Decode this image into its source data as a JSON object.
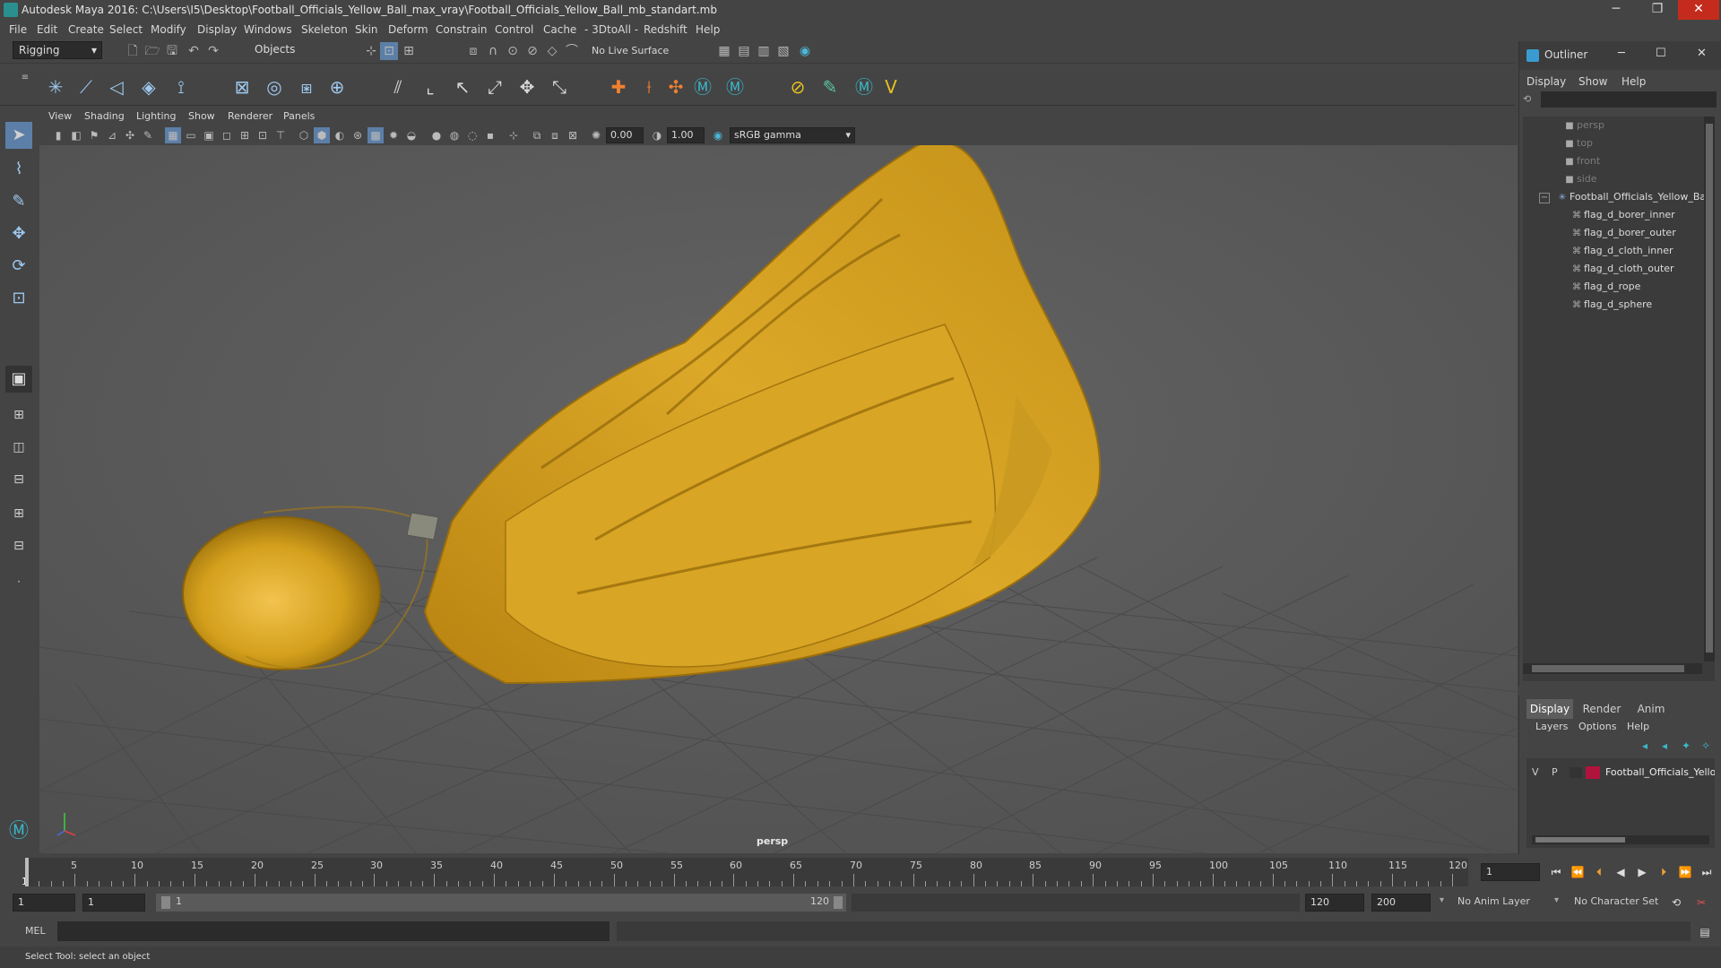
{
  "window": {
    "title": "Autodesk Maya 2016: C:\\Users\\I5\\Desktop\\Football_Officials_Yellow_Ball_max_vray\\Football_Officials_Yellow_Ball_mb_standart.mb",
    "minimize": "─",
    "maximize": "❐",
    "close": "✕"
  },
  "menubar": [
    "File",
    "Edit",
    "Create",
    "Select",
    "Modify",
    "Display",
    "Windows",
    "Skeleton",
    "Skin",
    "Deform",
    "Constrain",
    "Control",
    "Cache",
    "- 3DtoAll -",
    "Redshift",
    "Help"
  ],
  "statusline": {
    "menu_set": "Rigging",
    "selection_mode": "Objects",
    "live_surface": "No Live Surface"
  },
  "panel_menu": [
    "View",
    "Shading",
    "Lighting",
    "Show",
    "Renderer",
    "Panels"
  ],
  "panel_tools": {
    "exposure": "0.00",
    "gamma": "1.00",
    "color_space": "sRGB gamma"
  },
  "viewport": {
    "camera_label": "persp",
    "object_color": "#d6a21b"
  },
  "outliner": {
    "title": "Outliner",
    "menu": [
      "Display",
      "Show",
      "Help"
    ],
    "items": [
      {
        "label": "persp",
        "icon": "camera-icon",
        "dim": true
      },
      {
        "label": "top",
        "icon": "camera-icon",
        "dim": true
      },
      {
        "label": "front",
        "icon": "camera-icon",
        "dim": true
      },
      {
        "label": "side",
        "icon": "camera-icon",
        "dim": true
      },
      {
        "label": "Football_Officials_Yellow_Ba",
        "icon": "group-icon",
        "dim": false
      },
      {
        "label": "flag_d_borer_inner",
        "icon": "mesh-icon",
        "dim": false
      },
      {
        "label": "flag_d_borer_outer",
        "icon": "mesh-icon",
        "dim": false
      },
      {
        "label": "flag_d_cloth_inner",
        "icon": "mesh-icon",
        "dim": false
      },
      {
        "label": "flag_d_cloth_outer",
        "icon": "mesh-icon",
        "dim": false
      },
      {
        "label": "flag_d_rope",
        "icon": "mesh-icon",
        "dim": false
      },
      {
        "label": "flag_d_sphere",
        "icon": "mesh-icon",
        "dim": false
      }
    ]
  },
  "layer_editor": {
    "tabs": [
      "Display",
      "Render",
      "Anim"
    ],
    "menu": [
      "Layers",
      "Options",
      "Help"
    ],
    "layer": {
      "v": "V",
      "p": "P",
      "name": "Football_Officials_Yello",
      "color": "#b0143c"
    }
  },
  "timeline": {
    "ticks": [
      "5",
      "10",
      "15",
      "20",
      "25",
      "30",
      "35",
      "40",
      "45",
      "50",
      "55",
      "60",
      "65",
      "70",
      "75",
      "80",
      "85",
      "90",
      "95",
      "100",
      "105",
      "110",
      "115",
      "120"
    ],
    "start_label": "1",
    "current_frame": "1"
  },
  "range": {
    "start": "1",
    "playback_start": "1",
    "slider_start": "1",
    "slider_end": "120",
    "playback_end": "120",
    "end": "200",
    "anim_layer": "No Anim Layer",
    "character_set": "No Character Set"
  },
  "command_line": {
    "label": "MEL"
  },
  "help_line": "Select Tool: select an object"
}
